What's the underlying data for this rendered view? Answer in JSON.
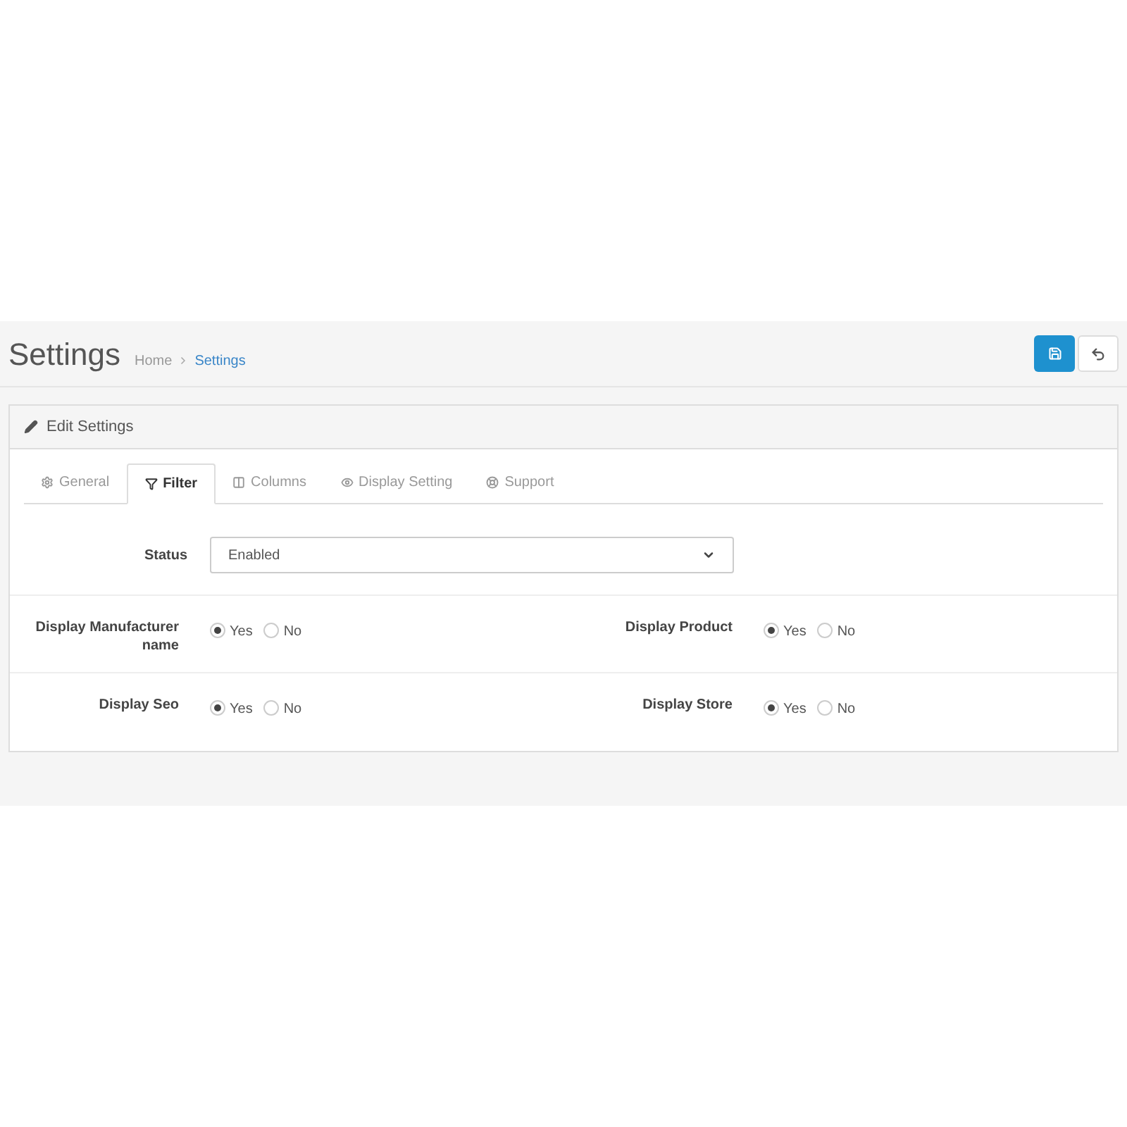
{
  "header": {
    "title": "Settings",
    "breadcrumb": [
      {
        "label": "Home",
        "selected": false
      },
      {
        "label": "Settings",
        "selected": true
      }
    ]
  },
  "panel": {
    "title": "Edit Settings",
    "tabs": [
      {
        "label": "General",
        "selected": false
      },
      {
        "label": "Filter",
        "selected": true
      },
      {
        "label": "Columns",
        "selected": false
      },
      {
        "label": "Display Setting",
        "selected": false
      },
      {
        "label": "Support",
        "selected": false
      }
    ],
    "status": {
      "label": "Status",
      "value": "Enabled"
    },
    "rows": [
      [
        {
          "label": "Display Manufacturer name",
          "options": [
            {
              "label": "Yes",
              "selected": true
            },
            {
              "label": "No",
              "selected": false
            }
          ]
        },
        {
          "label": "Display Product",
          "options": [
            {
              "label": "Yes",
              "selected": true
            },
            {
              "label": "No",
              "selected": false
            }
          ]
        }
      ],
      [
        {
          "label": "Display Seo",
          "options": [
            {
              "label": "Yes",
              "selected": true
            },
            {
              "label": "No",
              "selected": false
            }
          ]
        },
        {
          "label": "Display Store",
          "options": [
            {
              "label": "Yes",
              "selected": true
            },
            {
              "label": "No",
              "selected": false
            }
          ]
        }
      ]
    ]
  }
}
